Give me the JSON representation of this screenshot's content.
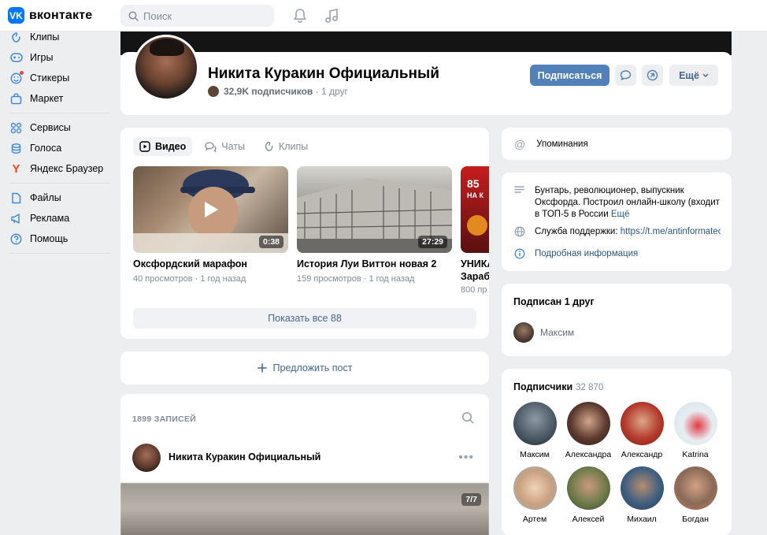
{
  "header": {
    "logo_text": "вконтакте",
    "logo_mark": "VK",
    "search_placeholder": "Поиск",
    "icons": [
      "bell-icon",
      "music-icon"
    ]
  },
  "sidebar": {
    "items": [
      {
        "label": "Клипы",
        "icon": "clips-icon"
      },
      {
        "label": "Игры",
        "icon": "gamepad-icon"
      },
      {
        "label": "Стикеры",
        "icon": "sticker-icon"
      },
      {
        "label": "Маркет",
        "icon": "bag-icon"
      },
      {
        "label": "Сервисы",
        "icon": "grid-icon"
      },
      {
        "label": "Голоса",
        "icon": "coins-icon"
      },
      {
        "label": "Яндекс Браузер",
        "icon": "yandex-icon"
      },
      {
        "label": "Файлы",
        "icon": "file-icon"
      },
      {
        "label": "Реклама",
        "icon": "megaphone-icon"
      },
      {
        "label": "Помощь",
        "icon": "help-icon"
      }
    ]
  },
  "profile": {
    "name": "Никита Куракин Официальный",
    "followers": "32,9K подписчиков",
    "friends": "1 друг",
    "subscribe_label": "Подписаться",
    "more_label": "Ещё"
  },
  "media": {
    "tabs": [
      {
        "label": "Видео",
        "active": true
      },
      {
        "label": "Чаты",
        "active": false
      },
      {
        "label": "Клипы",
        "active": false
      }
    ],
    "videos": [
      {
        "title": "Оксфордский марафон",
        "views": "40 просмотров",
        "age": "1 год назад",
        "duration": "0:38"
      },
      {
        "title": "История Луи Виттон новая 2",
        "views": "159 просмотров",
        "age": "1 год назад",
        "duration": "27:29"
      },
      {
        "title": "УНИКА",
        "subtitle": "Зарабо",
        "views": "800 пр",
        "badge_top": "85",
        "badge_mid": "НА К"
      }
    ],
    "show_all_label": "Показать все 88"
  },
  "suggest_label": "Предложить пост",
  "wall": {
    "count_label": "1899 ЗАПИСЕЙ",
    "post_author": "Никита Куракин Официальный",
    "photo_counter": "7/7"
  },
  "right": {
    "mentions_label": "Упоминания",
    "about_text": "Бунтарь, революционер, выпускник Оксфорда. Построил онлайн-школу (входит в ТОП-5 в России",
    "about_more": "Ещё",
    "support_label": "Служба поддержки:",
    "support_link": "https://t.me/antinformatec",
    "details_label": "Подробная информация",
    "friends_title": "Подписан 1 друг",
    "friend_name": "Максим",
    "subscribers_title": "Подписчики",
    "subscribers_count": "32 870",
    "subscribers": [
      "Максим",
      "Александра",
      "Александр",
      "Katrina",
      "Артем",
      "Алексей",
      "Михаил",
      "Богдан"
    ]
  }
}
